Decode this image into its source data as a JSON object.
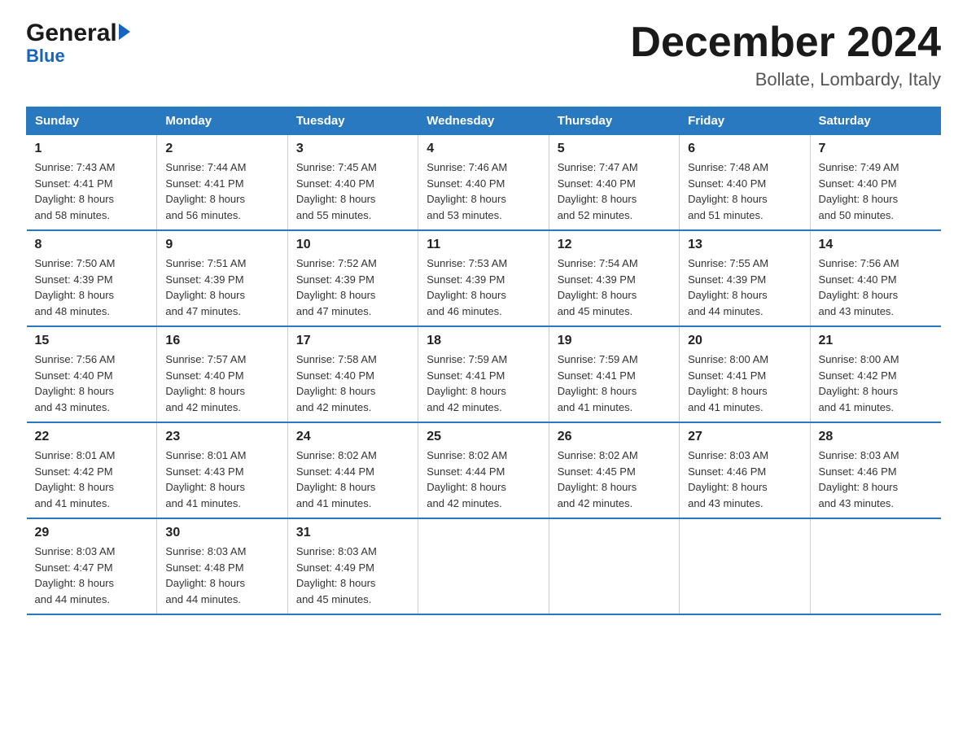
{
  "header": {
    "logo_general": "General",
    "logo_blue": "Blue",
    "month_title": "December 2024",
    "location": "Bollate, Lombardy, Italy"
  },
  "days_of_week": [
    "Sunday",
    "Monday",
    "Tuesday",
    "Wednesday",
    "Thursday",
    "Friday",
    "Saturday"
  ],
  "weeks": [
    [
      {
        "day": "1",
        "sunrise": "7:43 AM",
        "sunset": "4:41 PM",
        "daylight": "8 hours and 58 minutes."
      },
      {
        "day": "2",
        "sunrise": "7:44 AM",
        "sunset": "4:41 PM",
        "daylight": "8 hours and 56 minutes."
      },
      {
        "day": "3",
        "sunrise": "7:45 AM",
        "sunset": "4:40 PM",
        "daylight": "8 hours and 55 minutes."
      },
      {
        "day": "4",
        "sunrise": "7:46 AM",
        "sunset": "4:40 PM",
        "daylight": "8 hours and 53 minutes."
      },
      {
        "day": "5",
        "sunrise": "7:47 AM",
        "sunset": "4:40 PM",
        "daylight": "8 hours and 52 minutes."
      },
      {
        "day": "6",
        "sunrise": "7:48 AM",
        "sunset": "4:40 PM",
        "daylight": "8 hours and 51 minutes."
      },
      {
        "day": "7",
        "sunrise": "7:49 AM",
        "sunset": "4:40 PM",
        "daylight": "8 hours and 50 minutes."
      }
    ],
    [
      {
        "day": "8",
        "sunrise": "7:50 AM",
        "sunset": "4:39 PM",
        "daylight": "8 hours and 48 minutes."
      },
      {
        "day": "9",
        "sunrise": "7:51 AM",
        "sunset": "4:39 PM",
        "daylight": "8 hours and 47 minutes."
      },
      {
        "day": "10",
        "sunrise": "7:52 AM",
        "sunset": "4:39 PM",
        "daylight": "8 hours and 47 minutes."
      },
      {
        "day": "11",
        "sunrise": "7:53 AM",
        "sunset": "4:39 PM",
        "daylight": "8 hours and 46 minutes."
      },
      {
        "day": "12",
        "sunrise": "7:54 AM",
        "sunset": "4:39 PM",
        "daylight": "8 hours and 45 minutes."
      },
      {
        "day": "13",
        "sunrise": "7:55 AM",
        "sunset": "4:39 PM",
        "daylight": "8 hours and 44 minutes."
      },
      {
        "day": "14",
        "sunrise": "7:56 AM",
        "sunset": "4:40 PM",
        "daylight": "8 hours and 43 minutes."
      }
    ],
    [
      {
        "day": "15",
        "sunrise": "7:56 AM",
        "sunset": "4:40 PM",
        "daylight": "8 hours and 43 minutes."
      },
      {
        "day": "16",
        "sunrise": "7:57 AM",
        "sunset": "4:40 PM",
        "daylight": "8 hours and 42 minutes."
      },
      {
        "day": "17",
        "sunrise": "7:58 AM",
        "sunset": "4:40 PM",
        "daylight": "8 hours and 42 minutes."
      },
      {
        "day": "18",
        "sunrise": "7:59 AM",
        "sunset": "4:41 PM",
        "daylight": "8 hours and 42 minutes."
      },
      {
        "day": "19",
        "sunrise": "7:59 AM",
        "sunset": "4:41 PM",
        "daylight": "8 hours and 41 minutes."
      },
      {
        "day": "20",
        "sunrise": "8:00 AM",
        "sunset": "4:41 PM",
        "daylight": "8 hours and 41 minutes."
      },
      {
        "day": "21",
        "sunrise": "8:00 AM",
        "sunset": "4:42 PM",
        "daylight": "8 hours and 41 minutes."
      }
    ],
    [
      {
        "day": "22",
        "sunrise": "8:01 AM",
        "sunset": "4:42 PM",
        "daylight": "8 hours and 41 minutes."
      },
      {
        "day": "23",
        "sunrise": "8:01 AM",
        "sunset": "4:43 PM",
        "daylight": "8 hours and 41 minutes."
      },
      {
        "day": "24",
        "sunrise": "8:02 AM",
        "sunset": "4:44 PM",
        "daylight": "8 hours and 41 minutes."
      },
      {
        "day": "25",
        "sunrise": "8:02 AM",
        "sunset": "4:44 PM",
        "daylight": "8 hours and 42 minutes."
      },
      {
        "day": "26",
        "sunrise": "8:02 AM",
        "sunset": "4:45 PM",
        "daylight": "8 hours and 42 minutes."
      },
      {
        "day": "27",
        "sunrise": "8:03 AM",
        "sunset": "4:46 PM",
        "daylight": "8 hours and 43 minutes."
      },
      {
        "day": "28",
        "sunrise": "8:03 AM",
        "sunset": "4:46 PM",
        "daylight": "8 hours and 43 minutes."
      }
    ],
    [
      {
        "day": "29",
        "sunrise": "8:03 AM",
        "sunset": "4:47 PM",
        "daylight": "8 hours and 44 minutes."
      },
      {
        "day": "30",
        "sunrise": "8:03 AM",
        "sunset": "4:48 PM",
        "daylight": "8 hours and 44 minutes."
      },
      {
        "day": "31",
        "sunrise": "8:03 AM",
        "sunset": "4:49 PM",
        "daylight": "8 hours and 45 minutes."
      },
      null,
      null,
      null,
      null
    ]
  ],
  "labels": {
    "sunrise": "Sunrise: ",
    "sunset": "Sunset: ",
    "daylight": "Daylight: "
  }
}
